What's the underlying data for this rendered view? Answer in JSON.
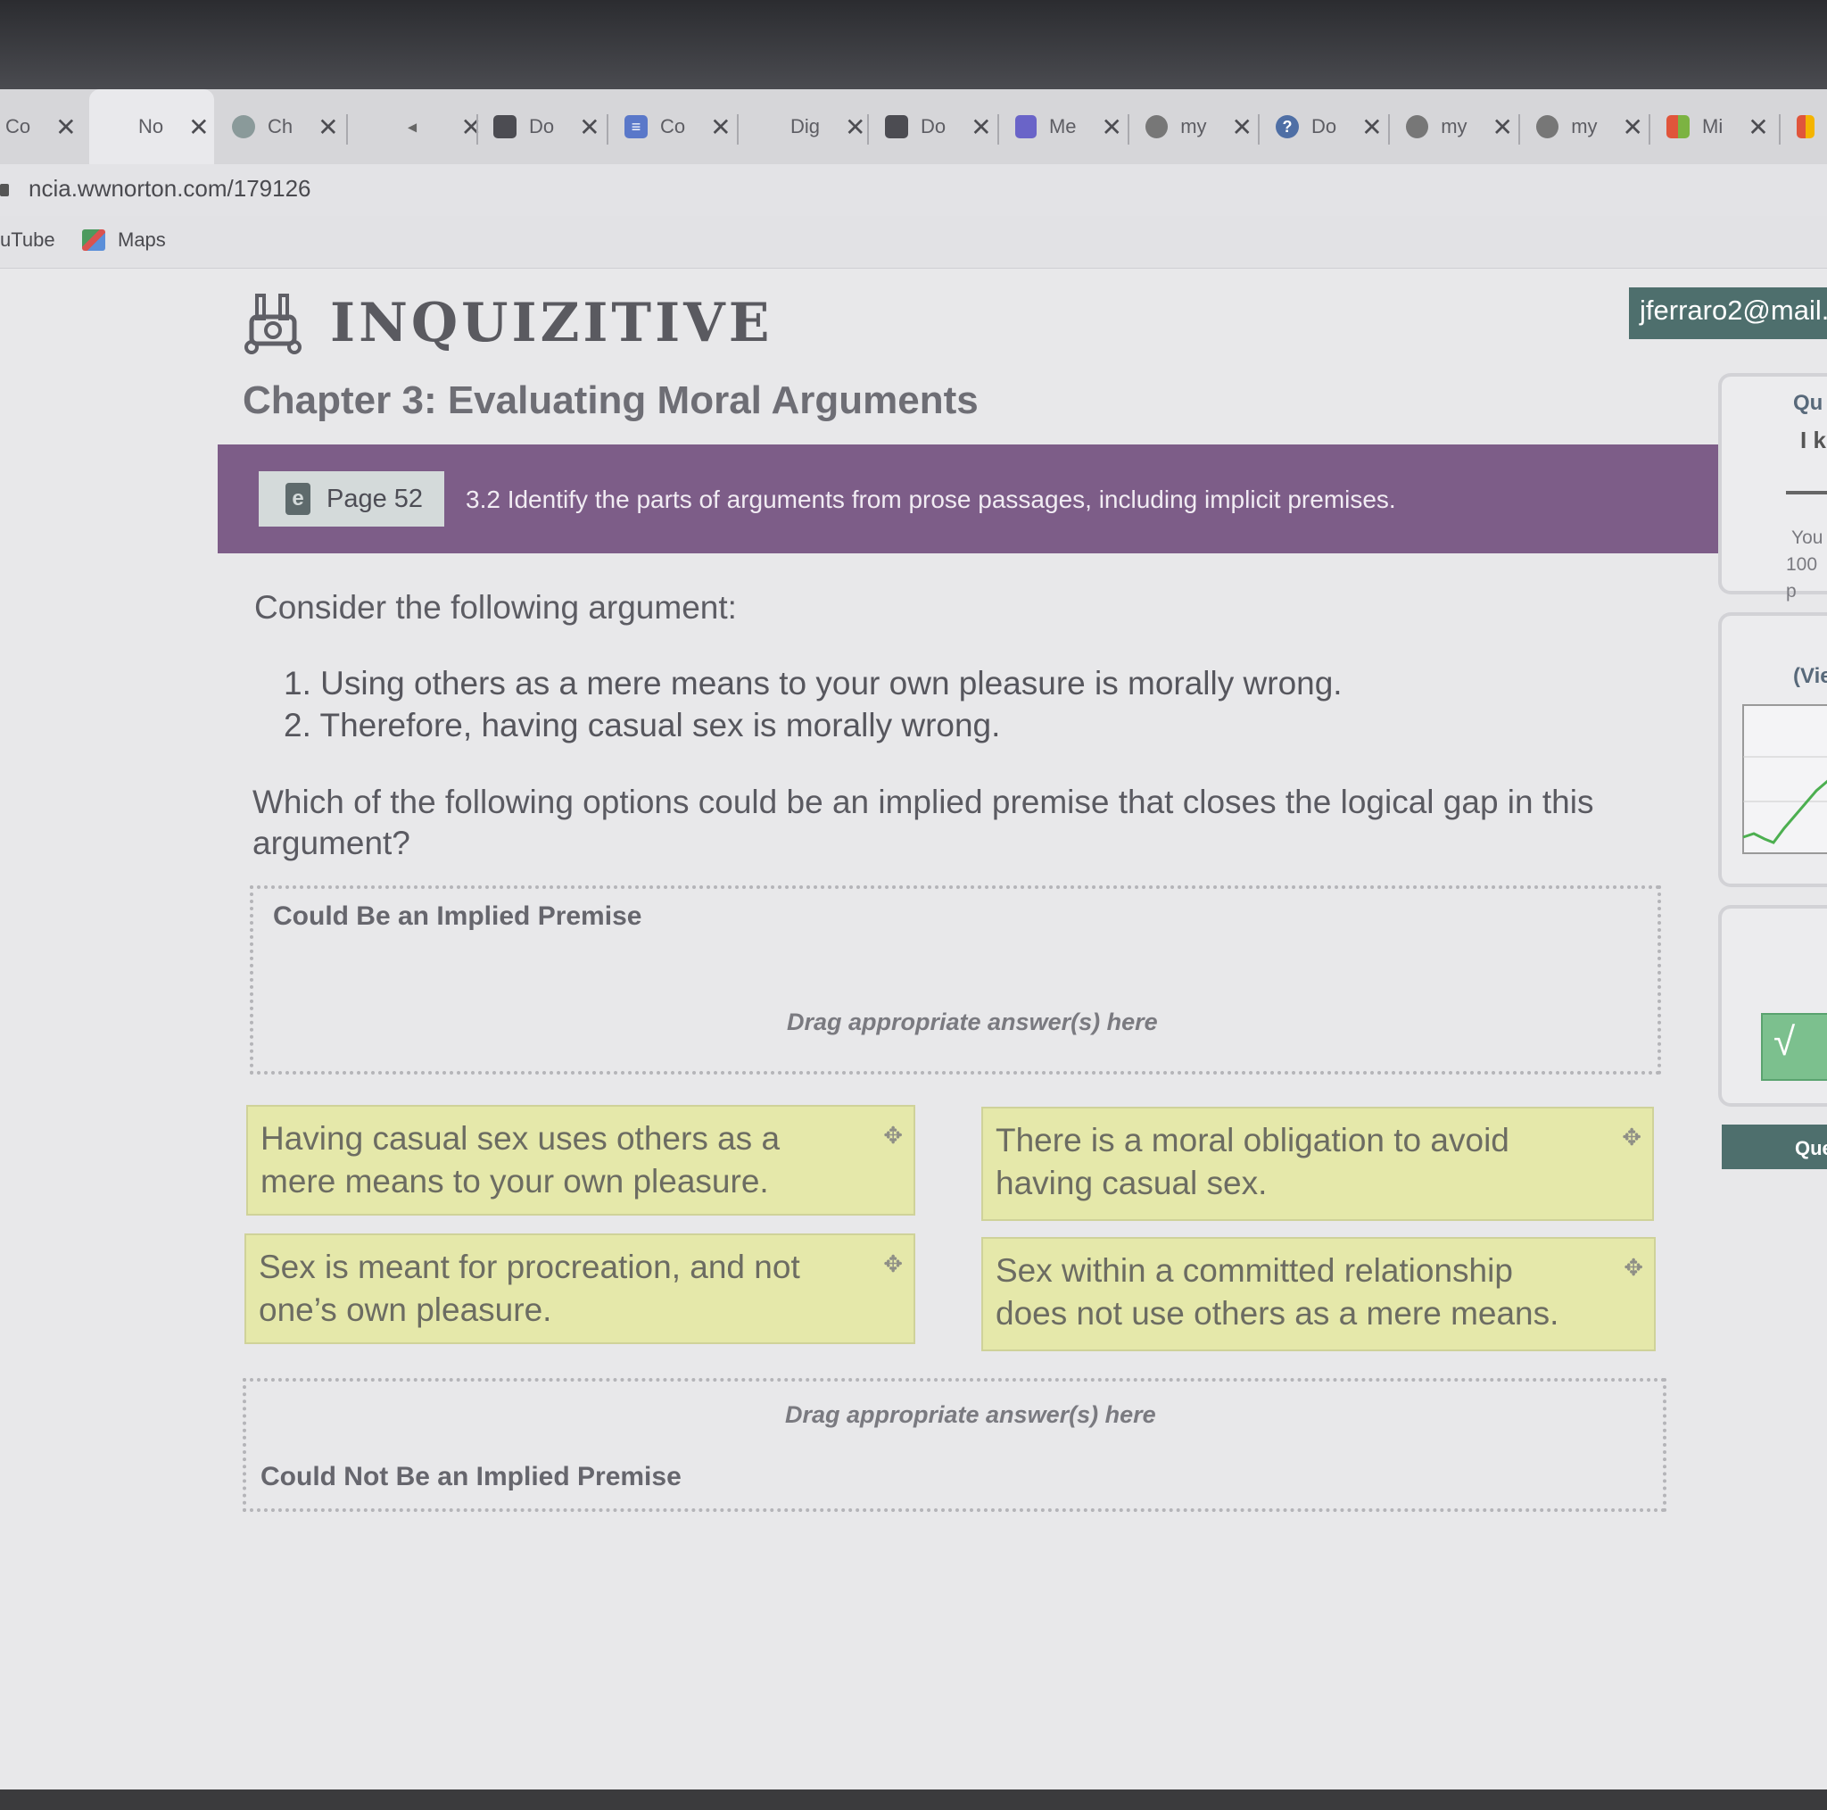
{
  "tabs": [
    {
      "label": "Co",
      "icon": "generic-icon"
    },
    {
      "label": "No",
      "icon": "none"
    },
    {
      "label": "Ch",
      "icon": "chat-icon"
    },
    {
      "label": "",
      "icon": "speaker-icon"
    },
    {
      "label": "Do",
      "icon": "doc-icon"
    },
    {
      "label": "Co",
      "icon": "list-icon"
    },
    {
      "label": "Dig",
      "icon": "none"
    },
    {
      "label": "Do",
      "icon": "doc-icon"
    },
    {
      "label": "Me",
      "icon": "shield-icon"
    },
    {
      "label": "my",
      "icon": "globe-icon"
    },
    {
      "label": "Do",
      "icon": "help-icon"
    },
    {
      "label": "my",
      "icon": "globe-icon"
    },
    {
      "label": "my",
      "icon": "globe-icon"
    },
    {
      "label": "Mi",
      "icon": "windows-icon"
    }
  ],
  "close_glyph": "✕",
  "url": "ncia.wwnorton.com/179126",
  "bookmarks": [
    "uTube",
    "Maps"
  ],
  "app": {
    "logo": "INQUIZITIVE",
    "chapter_title": "Chapter 3: Evaluating Moral Arguments",
    "user": "jferraro2@mail."
  },
  "objective": {
    "page_label": "Page 52",
    "text": "3.2 Identify the parts of arguments from prose passages, including implicit premises."
  },
  "question": {
    "intro": "Consider the following argument:",
    "premises": [
      "1. Using others as a mere means to your own pleasure is morally wrong.",
      "2. Therefore, having casual sex is morally wrong."
    ],
    "prompt": "Which of the following options could be an implied premise that closes the logical gap in this argument?"
  },
  "zones": {
    "top_title": "Could Be an Implied Premise",
    "top_hint": "Drag appropriate answer(s) here",
    "bottom_title": "Could Not Be an Implied Premise",
    "bottom_hint": "Drag appropriate answer(s) here"
  },
  "cards": [
    "Having casual sex uses others as a mere means to your own pleasure.",
    "There is a moral obligation to avoid having casual sex.",
    "Sex is meant for procreation, and not one’s own pleasure.",
    "Sex within a committed relationship does not use others as a mere means."
  ],
  "move_glyph": "✥",
  "side": {
    "q_label": "Qu",
    "ik_label": "I k",
    "you_text": "You",
    "points_text": "100 p",
    "view_label": "(Vie",
    "check_glyph": "√",
    "que_button": "Que"
  },
  "colors": {
    "objective_bar": "#7d5d88",
    "card_bg": "#e5e8aa",
    "user_badge": "#4e6f6d"
  }
}
